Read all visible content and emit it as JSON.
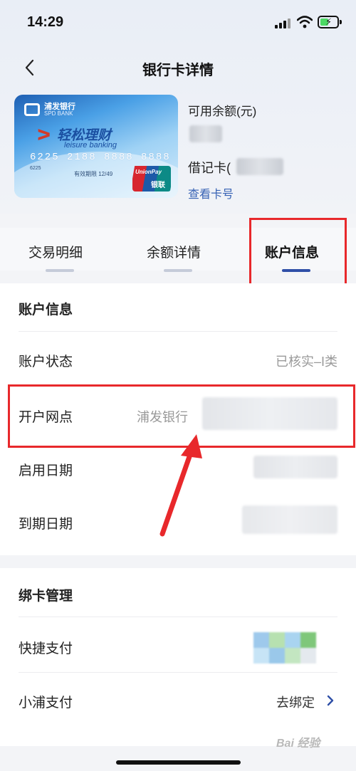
{
  "status": {
    "time": "14:29"
  },
  "nav": {
    "title": "银行卡详情"
  },
  "card": {
    "bank_name": "浦发银行",
    "bank_name_en": "SPD BANK",
    "product_name": "轻松理财",
    "product_name_en": "leisure banking",
    "card_number": "6225 2188 8888 8888",
    "sub_number": "6225",
    "expiry": "有效期限 12/49",
    "network": "UnionPay",
    "network_cn": "银联"
  },
  "card_info": {
    "available_balance_label": "可用余额(元)",
    "debit_label": "借记卡(",
    "view_card_no": "查看卡号"
  },
  "tabs": [
    {
      "label": "交易明细",
      "active": false
    },
    {
      "label": "余额详情",
      "active": false
    },
    {
      "label": "账户信息",
      "active": true
    }
  ],
  "account_info": {
    "title": "账户信息",
    "rows": [
      {
        "label": "账户状态",
        "value": "已核实–I类"
      },
      {
        "label": "开户网点",
        "value": "浦发银行"
      },
      {
        "label": "启用日期",
        "value": ""
      },
      {
        "label": "到期日期",
        "value": ""
      }
    ]
  },
  "binding": {
    "title": "绑卡管理",
    "rows": [
      {
        "label": "快捷支付",
        "value": ""
      },
      {
        "label": "小浦支付",
        "value": "去绑定"
      }
    ]
  },
  "watermark": "Bai 经验",
  "colors": {
    "accent": "#2f4fa7",
    "highlight": "#e8282b",
    "link": "#3863b5"
  }
}
